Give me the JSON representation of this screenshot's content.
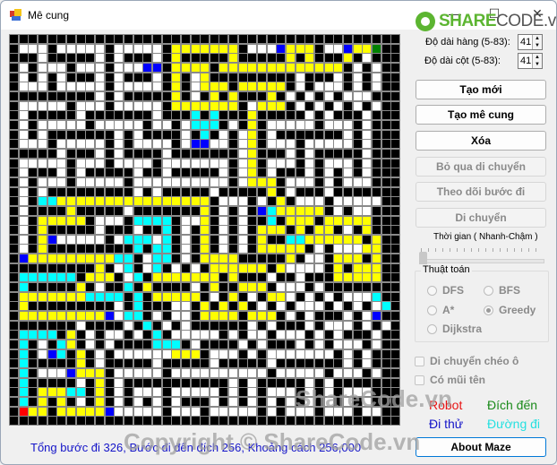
{
  "window": {
    "title": "Mê cung",
    "controls": {
      "minimize": "—",
      "maximize": "☐",
      "close": "✕"
    }
  },
  "watermark": {
    "logo_bold": "SHARE",
    "logo_rest": "CODE.vn",
    "overlay_1": "ShareCode.vn",
    "overlay_2": "Copyright © ShareCode.vn"
  },
  "settings": {
    "rows_label": "Độ dài hàng (5-83):",
    "rows_value": "41",
    "cols_label": "Độ dài cột (5-83):",
    "cols_value": "41"
  },
  "buttons": [
    {
      "id": "new",
      "label": "Tạo mới",
      "enabled": true
    },
    {
      "id": "generate",
      "label": "Tạo mê cung",
      "enabled": true
    },
    {
      "id": "clear",
      "label": "Xóa",
      "enabled": true
    },
    {
      "id": "skip",
      "label": "Bỏ qua di chuyển",
      "enabled": false
    },
    {
      "id": "track",
      "label": "Theo dõi bước đi",
      "enabled": false
    },
    {
      "id": "move",
      "label": "Di chuyển",
      "enabled": false
    }
  ],
  "speed": {
    "label": "Thời gian ( Nhanh-Chậm )",
    "value_fraction": 0.0
  },
  "algorithm": {
    "group_label": "Thuật toán",
    "options": [
      {
        "label": "DFS",
        "selected": false
      },
      {
        "label": "BFS",
        "selected": false
      },
      {
        "label": "A*",
        "selected": false
      },
      {
        "label": "Greedy",
        "selected": true
      },
      {
        "label": "Dijkstra",
        "selected": false
      }
    ]
  },
  "options": {
    "diagonal": {
      "label": "Di chuyển chéo ô",
      "checked": false
    },
    "arrows": {
      "label": "Có mũi tên",
      "checked": false
    }
  },
  "legend": {
    "robot": {
      "label": "Robot",
      "color": "#e81414"
    },
    "goal": {
      "label": "Đích đến",
      "color": "#1a8a1a"
    },
    "tried": {
      "label": "Đi thử",
      "color": "#1414c8"
    },
    "path": {
      "label": "Đường đi",
      "color": "#26e0e0"
    }
  },
  "about_button": "About Maze",
  "status": "Tổng bước đi 326, Bước đi đến đích 256, Khoảng cách 256,000",
  "maze": {
    "rows": 41,
    "cols": 41,
    "colors": {
      "#": "#000000",
      ".": "#ffffff",
      "Y": "#ffff00",
      "C": "#00ffff",
      "B": "#0000ff",
      "R": "#ff0000",
      "G": "#008000"
    },
    "grid": [
      "#########################################",
      "#...#.....#.....#YYYYYYY#...BYYY#..BYYG#",
      "###.#####.#.###.#Y#####Y#####Y#Y###Y#.#",
      "#.#...#...#...BB#YYYY#YYYYYYYYYYYYY#.#.#",
      "#.#.#.###.#.###.#Y#.Y#########.###.#.#.#",
      "#...#.....#.....#Y#.YYY#YYYYY#.#...#.#.#",
      "#########.#.#####Y#.#Y#Y###Y#.#.#.#...#",
      "#.....#...#.....#YYYYYYY#.YYY#.#.#.#.#.#",
      "#.#####.#######.###C#C###Y#####.#.###.#",
      "#.#.....#.....#..#.CCC#.#Y#.....#...#.#",
      "#.#.#######.#.####.#C#.#.Y#.#######.#.#",
      "#...#.....#.#....#.BB..#.Y#...#.....#.#",
      "#####.###.#.####.#######.Y###.#.#####.#",
      "#.....#...#....#.......#.Y#...#.#...#.#",
      "#.###.#.#####.##.#####.#.Y#.###.#.#.#.#",
      "#.#...#.....#..........#.YYY#...#.#...#",
      "#.#.#########.#.#####.#####Y#.###.#####",
      "#.#CCYYYYYYYYYYYYYYYY#...#.#Y#...#.....#",
      "#.####Y#####.#######Y#.#.#BCYYYYY#.#..##",
      "#.#YYYYY#...#CCCC#..Y#.#.##C#YYY#YYYYY#",
      "#.#Y#####.###.##C#.#Y#.#.#YYY#Y#YY#.#Y#",
      "#.#YB.....#.CCC.C#.#Y#.#.#Y##CCYYYYYY#Y#",
      "#.#Y#########C#CC#.#Y#.#.#YYYYY#.#...YY#",
      "#BYYYYYYYYYCC#.CC#.#YYYY#####Y#..#YYY#Y#",
      "#########Y#.C#.C#.#.#YYYYYY#Y....#Y#YYY#",
      "#CCCCCC#YYY#.C#YYYYYYY#Y###.##.###YYYYY#",
      "#C#####Y#.##C#Y####.#Y##YYY#...#.#######",
      "#YYYYYYYCCCC#C#YYYYY#.#Y#.#YY.#.#.#...C#",
      "#Y#########.#C###..#Y#Y#Y#.#.#...#.#.#.C#",
      "#YYYYYYYYYB.CC#.#..#YYYY#YYY#.#.###.#.B#",
      "#######.####.#C#.#.######.#.###.#...#.#.#",
      "#CCCC#Y#.#..#.#C#.....#.#..#...#.#.###.#",
      "#C#.#CY#.#.####CCC#.####.#.###.#.#...#.#",
      "#C#.BC#Y#.#......YYY#...#.#.......#.#.#",
      "#C#####Y#.#####.#####.#####.#######.#.#",
      "#C#...BYYY#.....#..........#.....#...#.#",
      "#C#####.#Y#.###########.#.#####.#.#####",
      "#C#YYYCC#Y#.#...#.....#.#.#...#.#.#...#",
      "#C#Y#Y#.#Y#.#.#.#.###.#.#.#.#.#.#.#.#.#",
      "#RYY#YYYYYB.....#...#.....#.#...#...#..#",
      "#########################################"
    ]
  }
}
